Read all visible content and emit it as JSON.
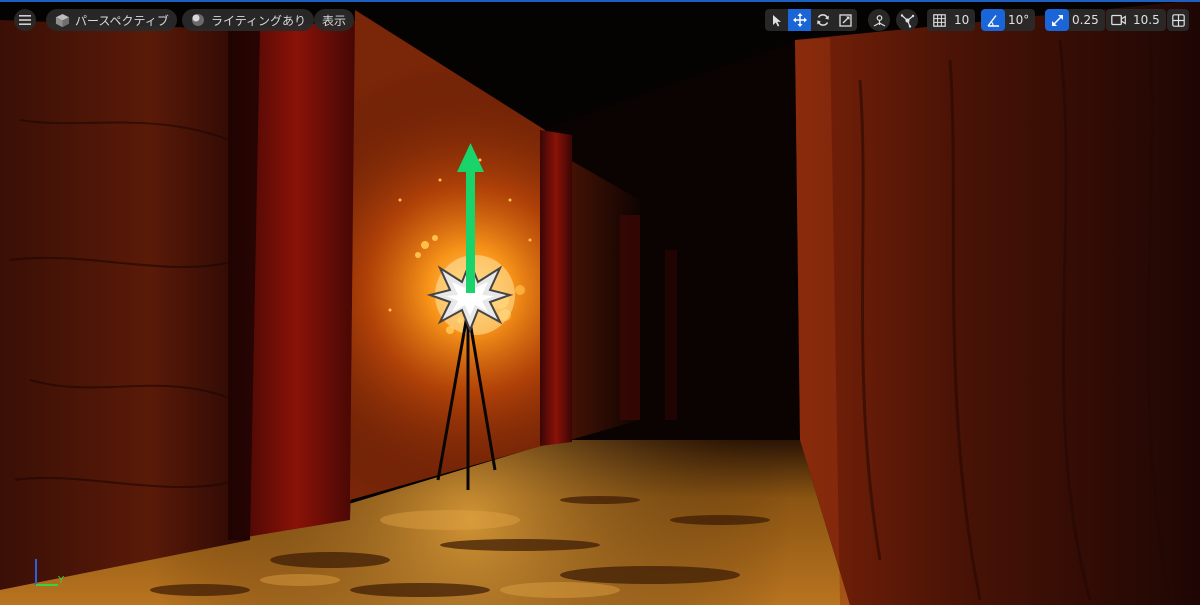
{
  "toolbar_left": {
    "menu_icon": "hamburger-icon",
    "perspective_label": "パースペクティブ",
    "lighting_label": "ライティングあり",
    "show_label": "表示"
  },
  "toolbar_right": {
    "transform_modes": [
      "select-icon",
      "move-icon",
      "rotate-icon",
      "scale-icon"
    ],
    "active_transform": "move-icon",
    "grid_snap_value": "10",
    "angle_snap_value": "10°",
    "scale_snap_value": "0.25",
    "camera_speed_value": "10.5"
  },
  "axis_indicator": {
    "y_label": "Y"
  },
  "colors": {
    "accent_blue": "#1a66d8",
    "gizmo_green": "#19d36b",
    "toolbar_bg": "#2a2a2a"
  }
}
